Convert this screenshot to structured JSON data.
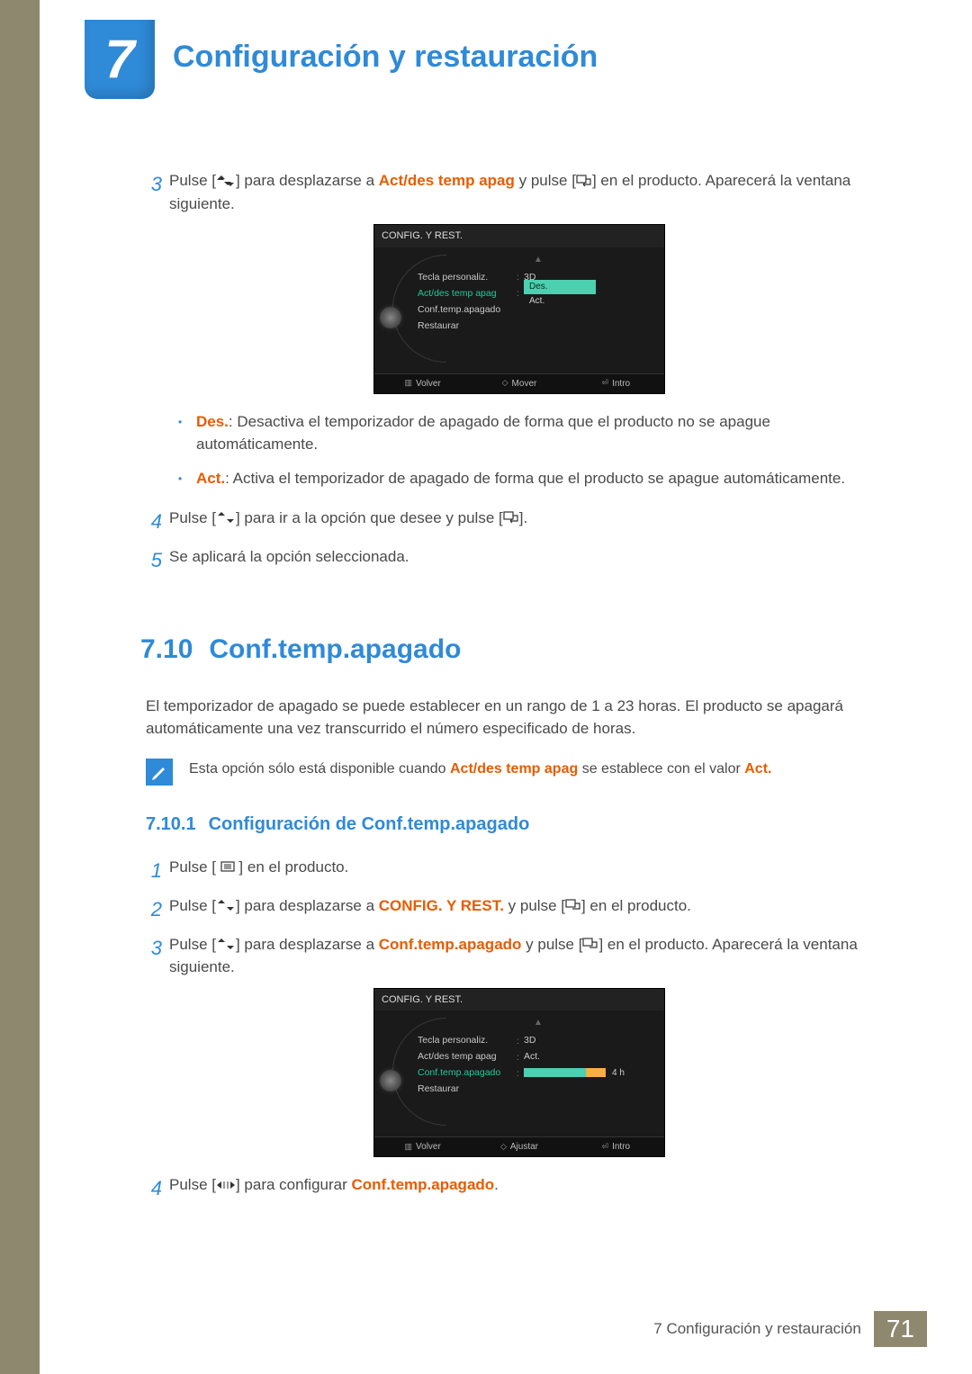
{
  "chapter": {
    "number": "7",
    "title": "Configuración y restauración"
  },
  "step3": {
    "num": "3",
    "text_before": "Pulse [",
    "text_mid1": "] para desplazarse a ",
    "highlight": "Act/des temp apag",
    "text_mid2": " y pulse [",
    "text_after": "] en el producto. Aparecerá la ventana siguiente."
  },
  "osd1": {
    "header": "CONFIG. Y REST.",
    "items": [
      {
        "label": "Tecla personaliz.",
        "value": "3D"
      },
      {
        "label": "Act/des temp apag",
        "value_selected": "Des.",
        "value_other": "Act."
      },
      {
        "label": "Conf.temp.apagado",
        "value": ""
      },
      {
        "label": "Restaurar",
        "value": ""
      }
    ],
    "footer": {
      "back": "Volver",
      "move": "Mover",
      "enter": "Intro"
    }
  },
  "bullets": [
    {
      "label": "Des.",
      "text": ": Desactiva el temporizador de apagado de forma que el producto no se apague automáticamente."
    },
    {
      "label": "Act.",
      "text": ": Activa el temporizador de apagado de forma que el producto se apague automáticamente."
    }
  ],
  "step4": {
    "num": "4",
    "text_before": "Pulse [",
    "text_mid": "] para ir a la opción que desee y pulse [",
    "text_after": "]."
  },
  "step5": {
    "num": "5",
    "text": "Se aplicará la opción seleccionada."
  },
  "section": {
    "num": "7.10",
    "title": "Conf.temp.apagado",
    "body": "El temporizador de apagado se puede establecer en un rango de 1 a 23 horas. El producto se apagará automáticamente una vez transcurrido el número especificado de horas."
  },
  "note": {
    "before": "Esta opción sólo está disponible cuando ",
    "hl1": "Act/des temp apag",
    "mid": " se establece con el valor ",
    "hl2": "Act.",
    "after": ""
  },
  "subsection": {
    "num": "7.10.1",
    "title": "Configuración de Conf.temp.apagado"
  },
  "sub_step1": {
    "num": "1",
    "before": "Pulse [ ",
    "after": " ] en el producto."
  },
  "sub_step2": {
    "num": "2",
    "before": "Pulse [",
    "mid1": "] para desplazarse a ",
    "hl": "CONFIG. Y REST.",
    "mid2": " y pulse [",
    "after": "] en el producto."
  },
  "sub_step3": {
    "num": "3",
    "before": "Pulse [",
    "mid1": "] para desplazarse a ",
    "hl": "Conf.temp.apagado",
    "mid2": " y pulse [",
    "after": "] en el producto. Aparecerá la ventana siguiente."
  },
  "osd2": {
    "header": "CONFIG. Y REST.",
    "items": [
      {
        "label": "Tecla personaliz.",
        "value": "3D"
      },
      {
        "label": "Act/des temp apag",
        "value": "Act."
      },
      {
        "label": "Conf.temp.apagado",
        "slider_value": "4 h"
      },
      {
        "label": "Restaurar",
        "value": ""
      }
    ],
    "footer": {
      "back": "Volver",
      "move": "Ajustar",
      "enter": "Intro"
    }
  },
  "sub_step4": {
    "num": "4",
    "before": "Pulse [",
    "mid": "] para configurar ",
    "hl": "Conf.temp.apagado",
    "after": "."
  },
  "footer": {
    "label": "7 Configuración y restauración",
    "page": "71"
  }
}
